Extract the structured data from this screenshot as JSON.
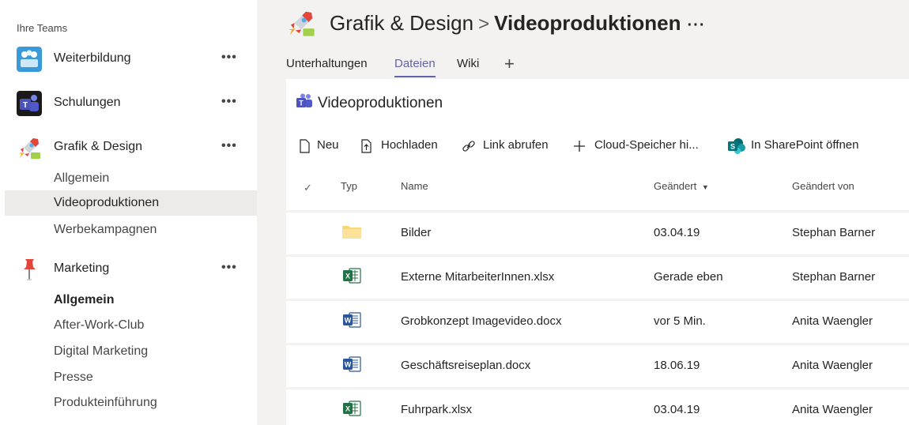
{
  "sidebar": {
    "heading": "Ihre Teams",
    "teams": [
      {
        "name": "Weiterbildung",
        "more": "•••",
        "icon": "people-board-icon"
      },
      {
        "name": "Schulungen",
        "more": "•••",
        "icon": "teams-logo-icon"
      },
      {
        "name": "Grafik & Design",
        "more": "•••",
        "icon": "rocket-icon"
      },
      {
        "name": "Marketing",
        "more": "•••",
        "icon": "pushpin-icon"
      }
    ],
    "grafik_channels": [
      "Allgemein",
      "Videoproduktionen",
      "Werbekampagnen"
    ],
    "marketing_channels": [
      "Allgemein",
      "After-Work-Club",
      "Digital Marketing",
      "Presse",
      "Produkteinführung"
    ]
  },
  "header": {
    "team": "Grafik & Design",
    "separator": ">",
    "channel": "Videoproduktionen",
    "more": "···"
  },
  "tabs": {
    "items": [
      "Unterhaltungen",
      "Dateien",
      "Wiki"
    ],
    "active": "Dateien",
    "add": "+"
  },
  "library": {
    "title": "Videoproduktionen"
  },
  "toolbar": {
    "new": "Neu",
    "upload": "Hochladen",
    "link": "Link abrufen",
    "cloud": "Cloud-Speicher hi...",
    "sharepoint": "In SharePoint öffnen"
  },
  "grid": {
    "columns": {
      "type": "Typ",
      "name": "Name",
      "modified": "Geändert",
      "modified_by": "Geändert von"
    },
    "rows": [
      {
        "type": "folder",
        "name": "Bilder",
        "modified": "03.04.19",
        "modified_by": "Stephan Barner"
      },
      {
        "type": "excel",
        "name": "Externe MitarbeiterInnen.xlsx",
        "modified": "Gerade eben",
        "modified_by": "Stephan Barner"
      },
      {
        "type": "word",
        "name": "Grobkonzept Imagevideo.docx",
        "modified": "vor 5 Min.",
        "modified_by": "Anita Waengler"
      },
      {
        "type": "word",
        "name": "Geschäftsreiseplan.docx",
        "modified": "18.06.19",
        "modified_by": "Anita Waengler"
      },
      {
        "type": "excel",
        "name": "Fuhrpark.xlsx",
        "modified": "03.04.19",
        "modified_by": "Anita Waengler"
      }
    ]
  },
  "colors": {
    "accent": "#6264a7",
    "excel": "#217346",
    "word": "#2b579a",
    "folder": "#f8d775"
  }
}
